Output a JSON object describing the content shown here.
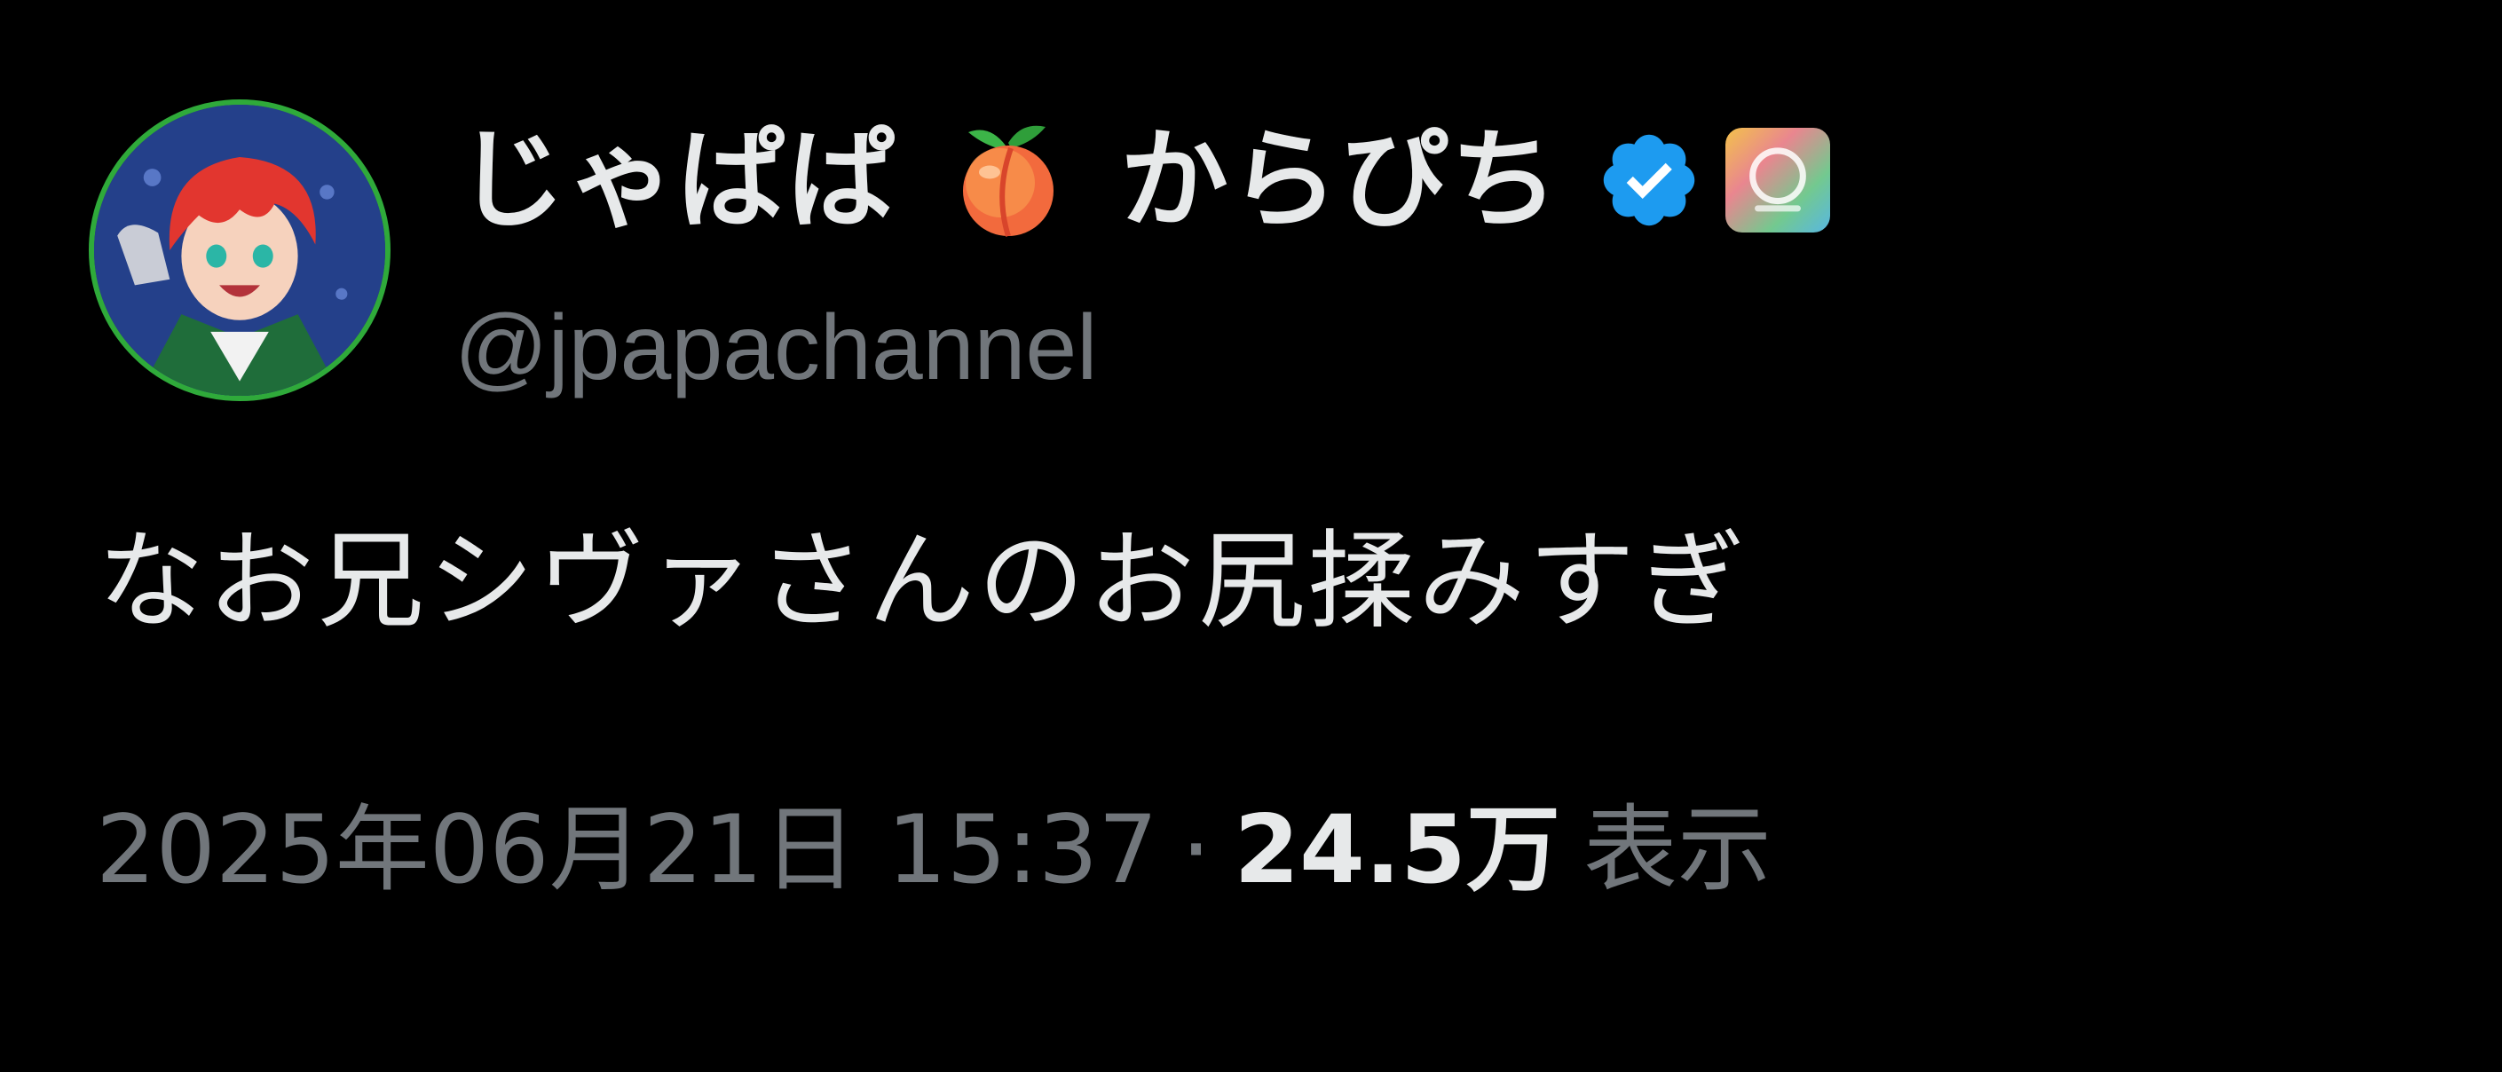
{
  "author": {
    "name_part1": "じゃぱぱ",
    "name_part2": "からぴち",
    "handle": "@jpapachannel",
    "avatar_icon": "avatar-icon",
    "name_emoji_icon": "peach-icon",
    "verified_icon": "verified-badge-icon",
    "affiliate_icon": "affiliate-badge-icon",
    "avatar_border_color": "#2faa3a",
    "verified_color": "#1d9bf0"
  },
  "tweet": {
    "text": "なお兄シヴァさんのお尻揉みすぎ",
    "timestamp": "2025年06月21日 15:37",
    "separator": "·",
    "views_count": "24.5万",
    "views_label": "表示"
  },
  "theme": {
    "background": "#000000",
    "primary_text": "#e7e9ea",
    "secondary_text": "#71767b"
  }
}
